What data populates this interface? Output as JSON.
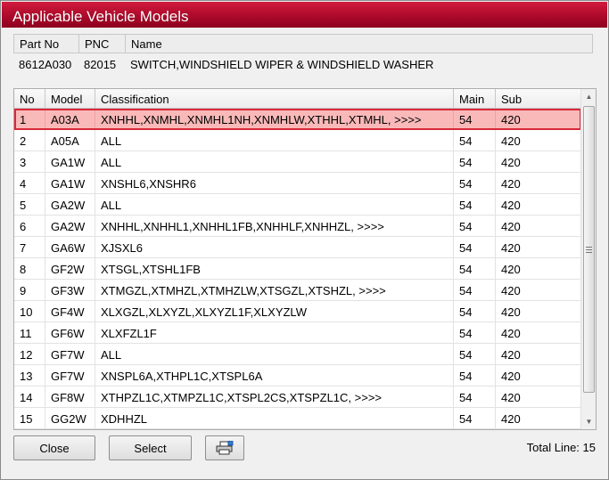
{
  "window": {
    "title": "Applicable Vehicle Models"
  },
  "part_info": {
    "headers": {
      "part_no": "Part No",
      "pnc": "PNC",
      "name": "Name"
    },
    "values": {
      "part_no": "8612A030",
      "pnc": "82015",
      "name": "SWITCH,WINDSHIELD WIPER & WINDSHIELD WASHER"
    }
  },
  "grid": {
    "headers": {
      "no": "No",
      "model": "Model",
      "classification": "Classification",
      "main": "Main",
      "sub": "Sub"
    },
    "rows": [
      {
        "no": "1",
        "model": "A03A",
        "classification": "XNHHL,XNMHL,XNMHL1NH,XNMHLW,XTHHL,XTMHL,   >>>>",
        "main": "54",
        "sub": "420"
      },
      {
        "no": "2",
        "model": "A05A",
        "classification": "ALL",
        "main": "54",
        "sub": "420"
      },
      {
        "no": "3",
        "model": "GA1W",
        "classification": "ALL",
        "main": "54",
        "sub": "420"
      },
      {
        "no": "4",
        "model": "GA1W",
        "classification": "XNSHL6,XNSHR6",
        "main": "54",
        "sub": "420"
      },
      {
        "no": "5",
        "model": "GA2W",
        "classification": "ALL",
        "main": "54",
        "sub": "420"
      },
      {
        "no": "6",
        "model": "GA2W",
        "classification": "XNHHL,XNHHL1,XNHHL1FB,XNHHLF,XNHHZL,   >>>>",
        "main": "54",
        "sub": "420"
      },
      {
        "no": "7",
        "model": "GA6W",
        "classification": "XJSXL6",
        "main": "54",
        "sub": "420"
      },
      {
        "no": "8",
        "model": "GF2W",
        "classification": "XTSGL,XTSHL1FB",
        "main": "54",
        "sub": "420"
      },
      {
        "no": "9",
        "model": "GF3W",
        "classification": "XTMGZL,XTMHZL,XTMHZLW,XTSGZL,XTSHZL,   >>>>",
        "main": "54",
        "sub": "420"
      },
      {
        "no": "10",
        "model": "GF4W",
        "classification": "XLXGZL,XLXYZL,XLXYZL1F,XLXYZLW",
        "main": "54",
        "sub": "420"
      },
      {
        "no": "11",
        "model": "GF6W",
        "classification": "XLXFZL1F",
        "main": "54",
        "sub": "420"
      },
      {
        "no": "12",
        "model": "GF7W",
        "classification": "ALL",
        "main": "54",
        "sub": "420"
      },
      {
        "no": "13",
        "model": "GF7W",
        "classification": "XNSPL6A,XTHPL1C,XTSPL6A",
        "main": "54",
        "sub": "420"
      },
      {
        "no": "14",
        "model": "GF8W",
        "classification": "XTHPZL1C,XTMPZL1C,XTSPL2CS,XTSPZL1C,   >>>>",
        "main": "54",
        "sub": "420"
      },
      {
        "no": "15",
        "model": "GG2W",
        "classification": "XDHHZL",
        "main": "54",
        "sub": "420"
      }
    ],
    "selected_row": 0
  },
  "buttons": {
    "close": "Close",
    "select": "Select",
    "print_icon": "printer-icon"
  },
  "footer": {
    "total_line": "Total Line: 15"
  },
  "colors": {
    "title_bar": "#b00b2c",
    "selected_row_bg": "#f9b9b9",
    "selected_row_border": "#d8283a"
  }
}
